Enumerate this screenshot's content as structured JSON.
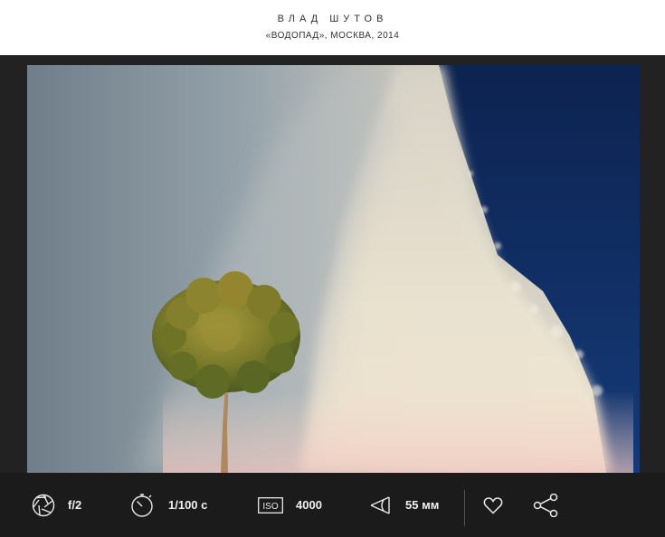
{
  "header": {
    "author": "ВЛАД ШУТОВ",
    "caption": "«ВОДОПАД», МОСКВА, 2014"
  },
  "photo": {
    "colors": {
      "sky": "#0f2a5c",
      "mist": "#dcd6c8",
      "foliage": "#7a7a2a",
      "trunk": "#b08860"
    }
  },
  "exif": {
    "aperture": {
      "icon": "aperture-icon",
      "value": "f/2"
    },
    "shutter": {
      "icon": "stopwatch-icon",
      "value": "1/100 с"
    },
    "iso": {
      "icon": "iso-icon",
      "label": "ISO",
      "value": "4000"
    },
    "focal": {
      "icon": "lens-angle-icon",
      "value": "55 мм"
    }
  },
  "actions": {
    "like": {
      "icon": "heart-icon"
    },
    "share": {
      "icon": "share-icon"
    }
  }
}
